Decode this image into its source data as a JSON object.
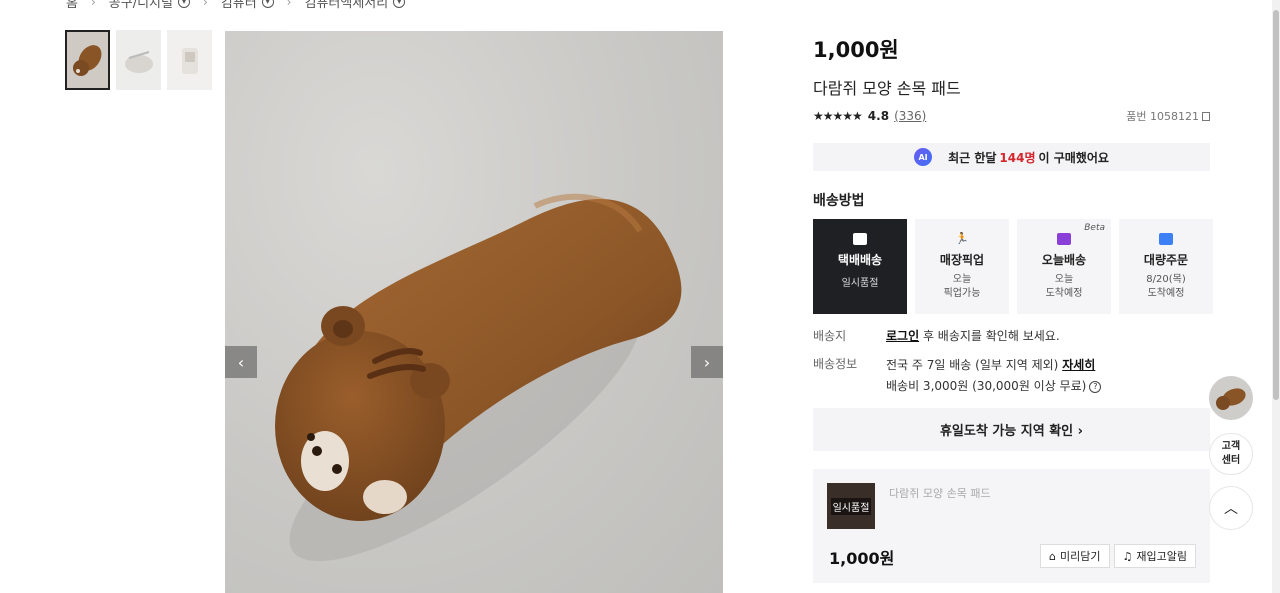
{
  "breadcrumb": [
    {
      "label": "홈",
      "has_toggle": false
    },
    {
      "label": "공구/디지털",
      "has_toggle": true
    },
    {
      "label": "컴퓨터",
      "has_toggle": true
    },
    {
      "label": "컴퓨터액세서리",
      "has_toggle": true
    }
  ],
  "breadcrumb_sep": "›",
  "toggle_glyph": "▾",
  "gallery": {
    "thumbnails": [
      "thumb-1",
      "thumb-2",
      "thumb-3"
    ],
    "prev_icon": "‹",
    "next_icon": "›"
  },
  "product": {
    "price": "1,000원",
    "name": "다람쥐 모양 손목 패드",
    "stars": "★★★★★",
    "rating": "4.8",
    "review_count": "(336)",
    "item_no": "품번 1058121"
  },
  "ai_banner": {
    "badge": "AI",
    "prefix": "최근 한달",
    "count": "144명",
    "suffix": "이 구매했어요"
  },
  "shipping": {
    "title": "배송방법",
    "options": [
      {
        "name": "택배배송",
        "sub": "일시품절",
        "icon": "truck-icon",
        "color": "#ffffff",
        "active": true
      },
      {
        "name": "매장픽업",
        "sub": "오늘\n픽업가능",
        "icon": "runner-icon",
        "color": "#e8313a",
        "active": false
      },
      {
        "name": "오늘배송",
        "sub": "오늘\n도착예정",
        "icon": "fast-truck-icon",
        "color": "#8b3fd9",
        "active": false,
        "beta": "Beta"
      },
      {
        "name": "대량주문",
        "sub": "8/20(목)\n도착예정",
        "icon": "box-icon",
        "color": "#3d7ff5",
        "active": false
      }
    ]
  },
  "delivery": {
    "dest_label": "배송지",
    "dest_login": "로그인",
    "dest_text": " 후 배송지를 확인해 보세요.",
    "info_label": "배송정보",
    "info_line1": "전국 주 7일 배송 (일부 지역 제외) ",
    "info_detail": "자세히",
    "info_line2": "배송비 3,000원 (30,000원 이상 무료)",
    "help_icon": "?"
  },
  "holiday_button": "휴일도착 가능 지역 확인 ›",
  "cart": {
    "badge": "일시품절",
    "name": "다람쥐 모양 손목 패드",
    "price": "1,000원",
    "wish_label": "미리담기",
    "alert_label": "재입고알림"
  },
  "side": {
    "cs_label_1": "고객",
    "cs_label_2": "센터",
    "top_icon": "︿"
  },
  "colors": {
    "accent_red": "#d3262d",
    "dark_card": "#1f2023"
  }
}
